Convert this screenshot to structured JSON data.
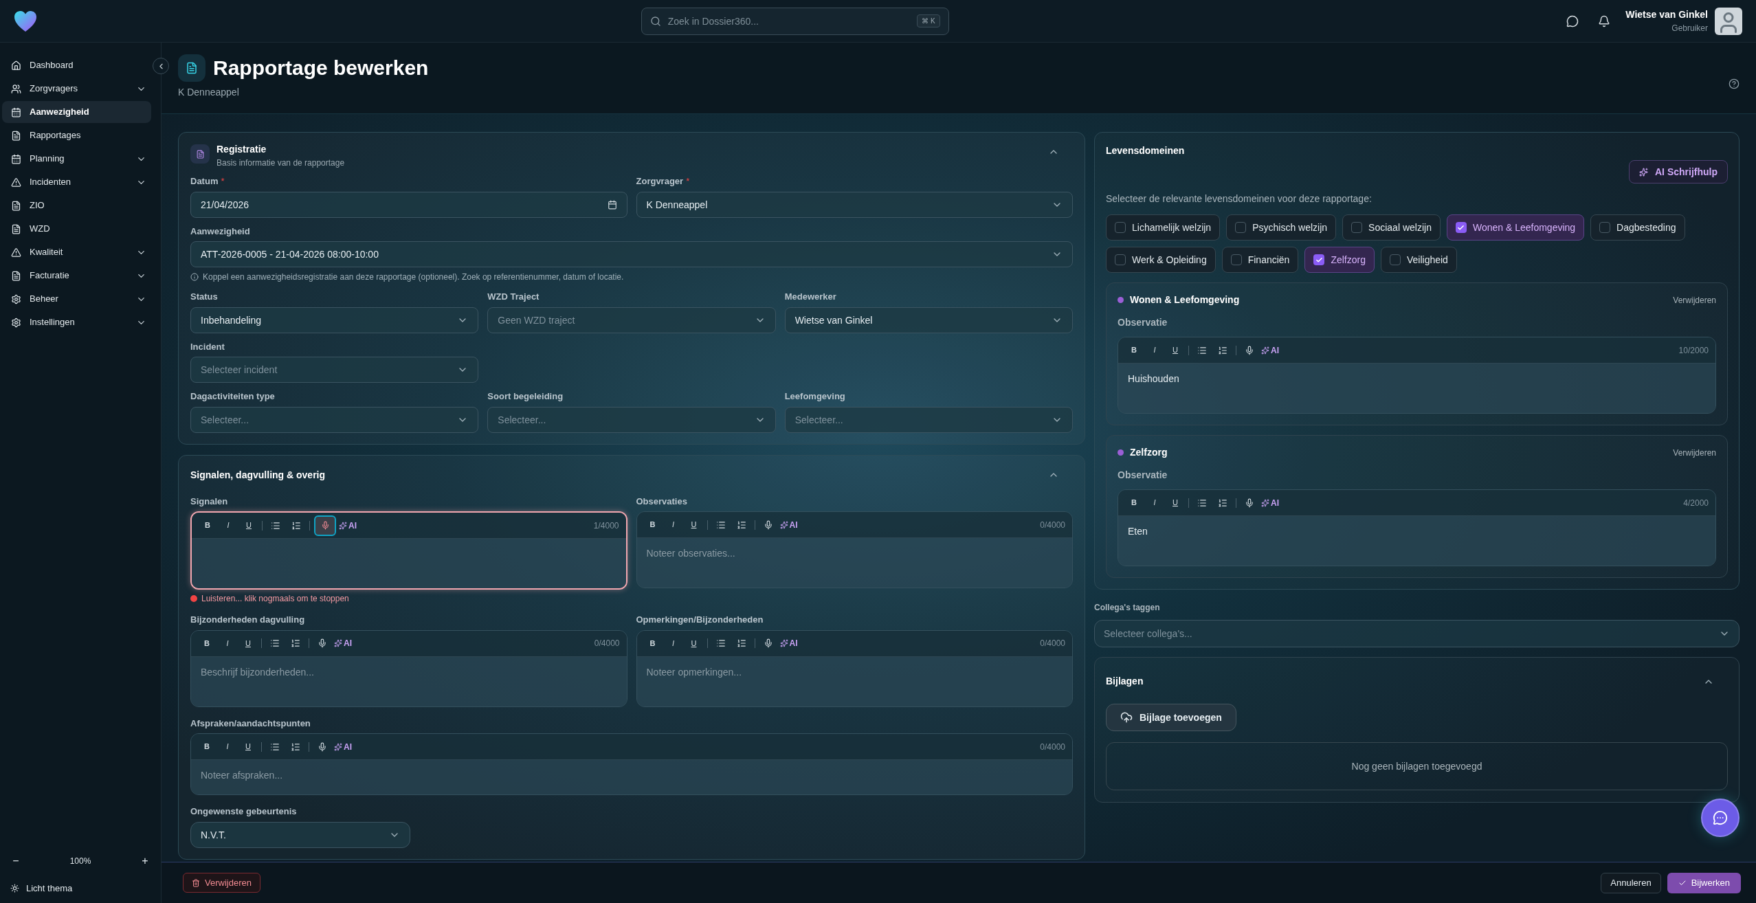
{
  "topbar": {
    "search_placeholder": "Zoek in Dossier360...",
    "search_shortcut": "⌘ K",
    "user": {
      "name": "Wietse van Ginkel",
      "role": "Gebruiker"
    }
  },
  "sidebar": {
    "items": [
      {
        "label": "Dashboard",
        "expandable": false,
        "selected": false
      },
      {
        "label": "Zorgvragers",
        "expandable": true,
        "selected": false
      },
      {
        "label": "Aanwezigheid",
        "expandable": false,
        "selected": true
      },
      {
        "label": "Rapportages",
        "expandable": false,
        "selected": false
      },
      {
        "label": "Planning",
        "expandable": true,
        "selected": false
      },
      {
        "label": "Incidenten",
        "expandable": true,
        "selected": false
      },
      {
        "label": "ZIO",
        "expandable": false,
        "selected": false
      },
      {
        "label": "WZD",
        "expandable": false,
        "selected": false
      },
      {
        "label": "Kwaliteit",
        "expandable": true,
        "selected": false
      },
      {
        "label": "Facturatie",
        "expandable": true,
        "selected": false
      },
      {
        "label": "Beheer",
        "expandable": true,
        "selected": false
      },
      {
        "label": "Instellingen",
        "expandable": true,
        "selected": false
      }
    ],
    "zoom": {
      "minus": "−",
      "level": "100%",
      "plus": "+"
    },
    "theme_toggle": "Licht thema"
  },
  "page": {
    "title": "Rapportage bewerken",
    "subtitle": "K Denneappel"
  },
  "registration": {
    "title": "Registratie",
    "subtitle": "Basis informatie van de rapportage",
    "expanded": true,
    "rows": [
      {
        "fields": [
          {
            "kind": "date",
            "label": "Datum",
            "required_mark": "*",
            "value": "21/04/2026"
          },
          {
            "kind": "select",
            "label": "Zorgvrager",
            "required_mark": "*",
            "value": "K Denneappel"
          }
        ]
      },
      {
        "fields": [
          {
            "kind": "select",
            "label": "Aanwezigheid",
            "value": "ATT-2026-0005 - 21-04-2026 08:00-10:00",
            "hint": "Koppel een aanwezigheidsregistratie aan deze rapportage (optioneel). Zoek op referentienummer, datum of locatie."
          }
        ]
      },
      {
        "fields": [
          {
            "kind": "select",
            "label": "Status",
            "value": "Inbehandeling"
          },
          {
            "kind": "select",
            "label": "WZD Traject",
            "placeholder": "Geen WZD traject"
          },
          {
            "kind": "select",
            "label": "Medewerker",
            "value": "Wietse van Ginkel"
          }
        ]
      },
      {
        "fields": [
          {
            "kind": "select",
            "label": "Incident",
            "placeholder": "Selecteer incident"
          }
        ]
      },
      {
        "fields": [
          {
            "kind": "select",
            "label": "Dagactiviteiten type",
            "placeholder": "Selecteer..."
          },
          {
            "kind": "select",
            "label": "Soort begeleiding",
            "placeholder": "Selecteer..."
          },
          {
            "kind": "select",
            "label": "Leefomgeving",
            "placeholder": "Selecteer..."
          }
        ]
      }
    ]
  },
  "signals": {
    "title": "Signalen, dagvulling & overig",
    "expanded": true,
    "rows": [
      {
        "editors": [
          {
            "label": "Signalen",
            "tools": [
              "B",
              "I",
              "U",
              "AI"
            ],
            "counter": "1/4000",
            "recording": true,
            "status": "Luisteren... klik nogmaals om te stoppen"
          },
          {
            "label": "Observaties",
            "tools": [
              "B",
              "I",
              "U",
              "AI"
            ],
            "counter": "0/4000",
            "recording": false,
            "placeholder": "Noteer observaties..."
          }
        ]
      },
      {
        "editors": [
          {
            "label": "Bijzonderheden dagvulling",
            "tools": [
              "B",
              "I",
              "U",
              "AI"
            ],
            "counter": "0/4000",
            "recording": false,
            "placeholder": "Beschrijf bijzonderheden..."
          },
          {
            "label": "Opmerkingen/Bijzonderheden",
            "tools": [
              "B",
              "I",
              "U",
              "AI"
            ],
            "counter": "0/4000",
            "recording": false,
            "placeholder": "Noteer opmerkingen..."
          }
        ]
      },
      {
        "editors": [
          {
            "label": "Afspraken/aandachtspunten",
            "tools": [
              "B",
              "I",
              "U",
              "AI"
            ],
            "counter": "0/4000",
            "recording": false,
            "placeholder": "Noteer afspraken..."
          }
        ]
      }
    ],
    "event_field": {
      "label": "Ongewenste gebeurtenis",
      "value": "N.V.T."
    }
  },
  "life_domains": {
    "title": "Levensdomeinen",
    "ai_button": "AI Schrijfhulp",
    "prompt": "Selecteer de relevante levensdomeinen voor deze rapportage:",
    "domains": [
      {
        "label": "Lichamelijk welzijn",
        "checked": false
      },
      {
        "label": "Psychisch welzijn",
        "checked": false
      },
      {
        "label": "Sociaal welzijn",
        "checked": false
      },
      {
        "label": "Wonen & Leefomgeving",
        "checked": true
      },
      {
        "label": "Dagbesteding",
        "checked": false
      },
      {
        "label": "Werk & Opleiding",
        "checked": false
      },
      {
        "label": "Financiën",
        "checked": false
      },
      {
        "label": "Zelfzorg",
        "checked": true
      },
      {
        "label": "Veiligheid",
        "checked": false
      }
    ],
    "entries": [
      {
        "title": "Wonen & Leefomgeving",
        "remove": "Verwijderen",
        "field_label": "Observatie",
        "editor": {
          "tools": [
            "B",
            "I",
            "U",
            "AI"
          ],
          "counter": "10/2000",
          "recording": false,
          "value": "Huishouden"
        }
      },
      {
        "title": "Zelfzorg",
        "remove": "Verwijderen",
        "field_label": "Observatie",
        "editor": {
          "tools": [
            "B",
            "I",
            "U",
            "AI"
          ],
          "counter": "4/2000",
          "recording": false,
          "value": "Eten"
        }
      }
    ]
  },
  "colleagues": {
    "label": "Collega's taggen",
    "placeholder": "Selecteer collega's..."
  },
  "attachments": {
    "title": "Bijlagen",
    "expanded": true,
    "add_button": "Bijlage toevoegen",
    "empty": "Nog geen bijlagen toegevoegd"
  },
  "footer": {
    "delete": "Verwijderen",
    "cancel": "Annuleren",
    "submit": "Bijwerken"
  }
}
